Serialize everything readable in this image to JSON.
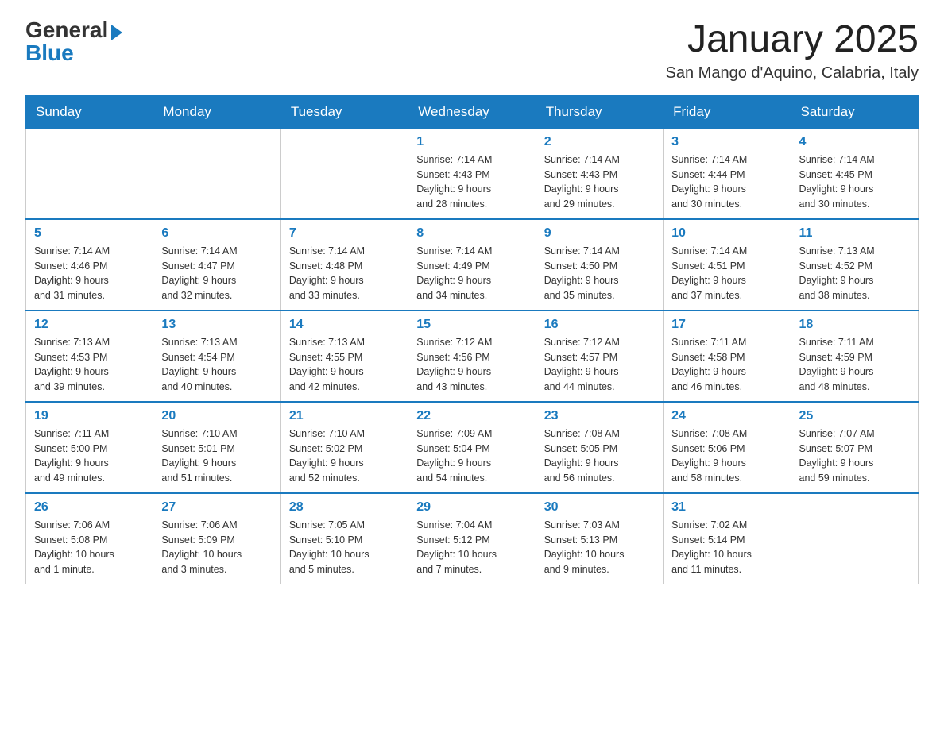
{
  "logo": {
    "general": "General",
    "blue": "Blue"
  },
  "title": "January 2025",
  "location": "San Mango d'Aquino, Calabria, Italy",
  "days_of_week": [
    "Sunday",
    "Monday",
    "Tuesday",
    "Wednesday",
    "Thursday",
    "Friday",
    "Saturday"
  ],
  "weeks": [
    [
      {
        "day": "",
        "info": ""
      },
      {
        "day": "",
        "info": ""
      },
      {
        "day": "",
        "info": ""
      },
      {
        "day": "1",
        "info": "Sunrise: 7:14 AM\nSunset: 4:43 PM\nDaylight: 9 hours\nand 28 minutes."
      },
      {
        "day": "2",
        "info": "Sunrise: 7:14 AM\nSunset: 4:43 PM\nDaylight: 9 hours\nand 29 minutes."
      },
      {
        "day": "3",
        "info": "Sunrise: 7:14 AM\nSunset: 4:44 PM\nDaylight: 9 hours\nand 30 minutes."
      },
      {
        "day": "4",
        "info": "Sunrise: 7:14 AM\nSunset: 4:45 PM\nDaylight: 9 hours\nand 30 minutes."
      }
    ],
    [
      {
        "day": "5",
        "info": "Sunrise: 7:14 AM\nSunset: 4:46 PM\nDaylight: 9 hours\nand 31 minutes."
      },
      {
        "day": "6",
        "info": "Sunrise: 7:14 AM\nSunset: 4:47 PM\nDaylight: 9 hours\nand 32 minutes."
      },
      {
        "day": "7",
        "info": "Sunrise: 7:14 AM\nSunset: 4:48 PM\nDaylight: 9 hours\nand 33 minutes."
      },
      {
        "day": "8",
        "info": "Sunrise: 7:14 AM\nSunset: 4:49 PM\nDaylight: 9 hours\nand 34 minutes."
      },
      {
        "day": "9",
        "info": "Sunrise: 7:14 AM\nSunset: 4:50 PM\nDaylight: 9 hours\nand 35 minutes."
      },
      {
        "day": "10",
        "info": "Sunrise: 7:14 AM\nSunset: 4:51 PM\nDaylight: 9 hours\nand 37 minutes."
      },
      {
        "day": "11",
        "info": "Sunrise: 7:13 AM\nSunset: 4:52 PM\nDaylight: 9 hours\nand 38 minutes."
      }
    ],
    [
      {
        "day": "12",
        "info": "Sunrise: 7:13 AM\nSunset: 4:53 PM\nDaylight: 9 hours\nand 39 minutes."
      },
      {
        "day": "13",
        "info": "Sunrise: 7:13 AM\nSunset: 4:54 PM\nDaylight: 9 hours\nand 40 minutes."
      },
      {
        "day": "14",
        "info": "Sunrise: 7:13 AM\nSunset: 4:55 PM\nDaylight: 9 hours\nand 42 minutes."
      },
      {
        "day": "15",
        "info": "Sunrise: 7:12 AM\nSunset: 4:56 PM\nDaylight: 9 hours\nand 43 minutes."
      },
      {
        "day": "16",
        "info": "Sunrise: 7:12 AM\nSunset: 4:57 PM\nDaylight: 9 hours\nand 44 minutes."
      },
      {
        "day": "17",
        "info": "Sunrise: 7:11 AM\nSunset: 4:58 PM\nDaylight: 9 hours\nand 46 minutes."
      },
      {
        "day": "18",
        "info": "Sunrise: 7:11 AM\nSunset: 4:59 PM\nDaylight: 9 hours\nand 48 minutes."
      }
    ],
    [
      {
        "day": "19",
        "info": "Sunrise: 7:11 AM\nSunset: 5:00 PM\nDaylight: 9 hours\nand 49 minutes."
      },
      {
        "day": "20",
        "info": "Sunrise: 7:10 AM\nSunset: 5:01 PM\nDaylight: 9 hours\nand 51 minutes."
      },
      {
        "day": "21",
        "info": "Sunrise: 7:10 AM\nSunset: 5:02 PM\nDaylight: 9 hours\nand 52 minutes."
      },
      {
        "day": "22",
        "info": "Sunrise: 7:09 AM\nSunset: 5:04 PM\nDaylight: 9 hours\nand 54 minutes."
      },
      {
        "day": "23",
        "info": "Sunrise: 7:08 AM\nSunset: 5:05 PM\nDaylight: 9 hours\nand 56 minutes."
      },
      {
        "day": "24",
        "info": "Sunrise: 7:08 AM\nSunset: 5:06 PM\nDaylight: 9 hours\nand 58 minutes."
      },
      {
        "day": "25",
        "info": "Sunrise: 7:07 AM\nSunset: 5:07 PM\nDaylight: 9 hours\nand 59 minutes."
      }
    ],
    [
      {
        "day": "26",
        "info": "Sunrise: 7:06 AM\nSunset: 5:08 PM\nDaylight: 10 hours\nand 1 minute."
      },
      {
        "day": "27",
        "info": "Sunrise: 7:06 AM\nSunset: 5:09 PM\nDaylight: 10 hours\nand 3 minutes."
      },
      {
        "day": "28",
        "info": "Sunrise: 7:05 AM\nSunset: 5:10 PM\nDaylight: 10 hours\nand 5 minutes."
      },
      {
        "day": "29",
        "info": "Sunrise: 7:04 AM\nSunset: 5:12 PM\nDaylight: 10 hours\nand 7 minutes."
      },
      {
        "day": "30",
        "info": "Sunrise: 7:03 AM\nSunset: 5:13 PM\nDaylight: 10 hours\nand 9 minutes."
      },
      {
        "day": "31",
        "info": "Sunrise: 7:02 AM\nSunset: 5:14 PM\nDaylight: 10 hours\nand 11 minutes."
      },
      {
        "day": "",
        "info": ""
      }
    ]
  ]
}
